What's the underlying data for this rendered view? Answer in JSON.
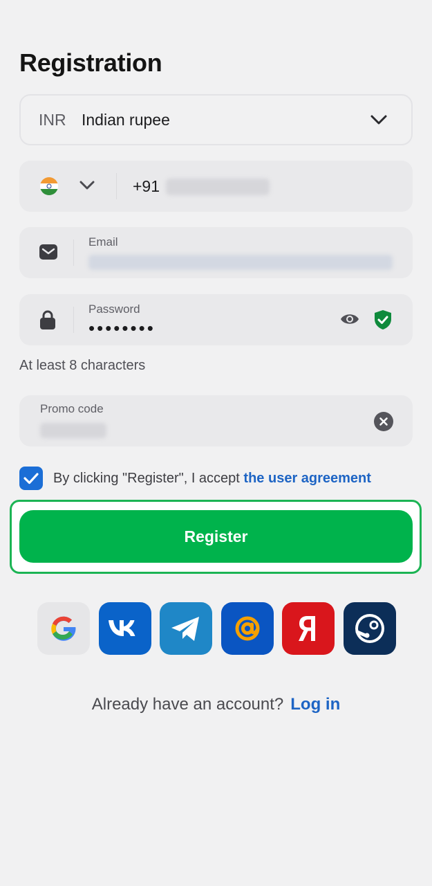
{
  "page": {
    "title": "Registration"
  },
  "currency": {
    "code": "INR",
    "name": "Indian rupee"
  },
  "phone": {
    "country_code": "+91"
  },
  "email": {
    "label": "Email"
  },
  "password": {
    "label": "Password",
    "value_masked": "••••••••",
    "hint": "At least 8 characters"
  },
  "promo": {
    "label": "Promo code"
  },
  "agreement": {
    "text": "By clicking \"Register\", I accept ",
    "link": "the user agreement",
    "checked": true
  },
  "register": {
    "label": "Register"
  },
  "social": [
    {
      "name": "google",
      "icon": "google-icon"
    },
    {
      "name": "vk",
      "icon": "vk-icon"
    },
    {
      "name": "telegram",
      "icon": "telegram-icon"
    },
    {
      "name": "mail",
      "icon": "mail-ru-icon"
    },
    {
      "name": "yandex",
      "icon": "yandex-icon"
    },
    {
      "name": "steam",
      "icon": "steam-icon"
    }
  ],
  "login": {
    "prompt": "Already have an account?",
    "link": "Log in"
  },
  "colors": {
    "accent": "#00b34c",
    "link": "#1d64c4",
    "checkbox": "#1b6ed6"
  }
}
